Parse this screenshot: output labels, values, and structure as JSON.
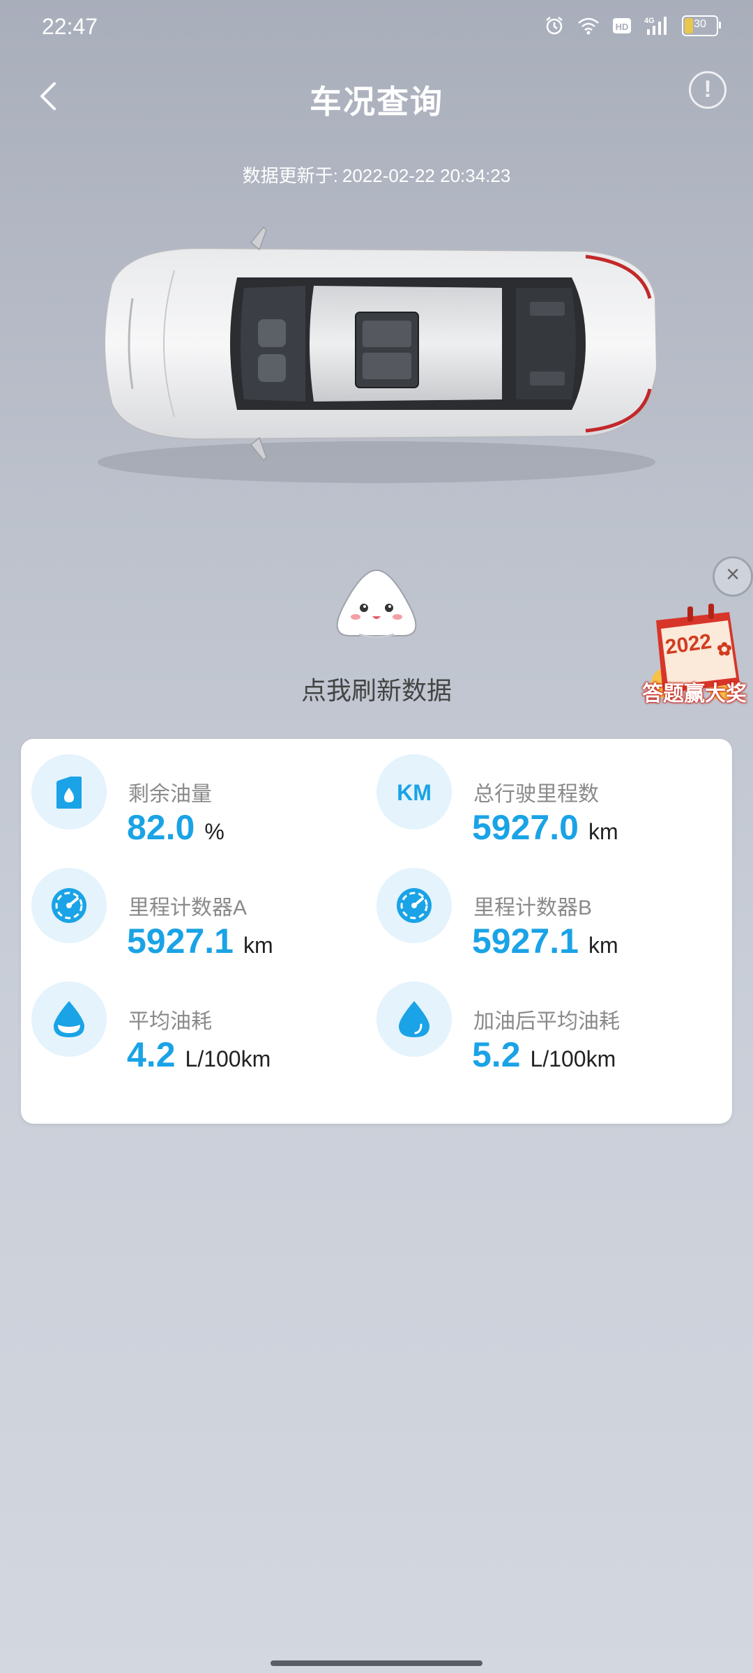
{
  "status_bar": {
    "time": "22:47",
    "battery": "30",
    "icons": [
      "alarm-icon",
      "wifi-icon",
      "hd-icon",
      "signal-4g-icon",
      "battery-icon"
    ]
  },
  "header": {
    "title": "车况查询",
    "back_icon": "chevron-left-icon",
    "info_icon": "info-icon",
    "info_glyph": "!"
  },
  "updated": {
    "label": "数据更新于:",
    "value": "2022-02-22 20:34:23"
  },
  "refresh": {
    "text": "点我刷新数据"
  },
  "promo": {
    "year": "2022",
    "text": "答题赢大奖",
    "close_glyph": "×"
  },
  "stats": [
    {
      "label": "剩余油量",
      "value": "82.0",
      "unit": "%",
      "icon": "fuel-can-icon"
    },
    {
      "label": "总行驶里程数",
      "value": "5927.0",
      "unit": "km",
      "icon": "km-icon",
      "icon_text": "KM"
    },
    {
      "label": "里程计数器A",
      "value": "5927.1",
      "unit": "km",
      "icon": "gauge-icon"
    },
    {
      "label": "里程计数器B",
      "value": "5927.1",
      "unit": "km",
      "icon": "gauge-icon"
    },
    {
      "label": "平均油耗",
      "value": "4.2",
      "unit": "L/100km",
      "icon": "fuel-drop-half-icon"
    },
    {
      "label": "加油后平均油耗",
      "value": "5.2",
      "unit": "L/100km",
      "icon": "fuel-drop-icon"
    }
  ],
  "colors": {
    "accent": "#1aa3e6",
    "icon_bg": "#e4f3fc"
  }
}
